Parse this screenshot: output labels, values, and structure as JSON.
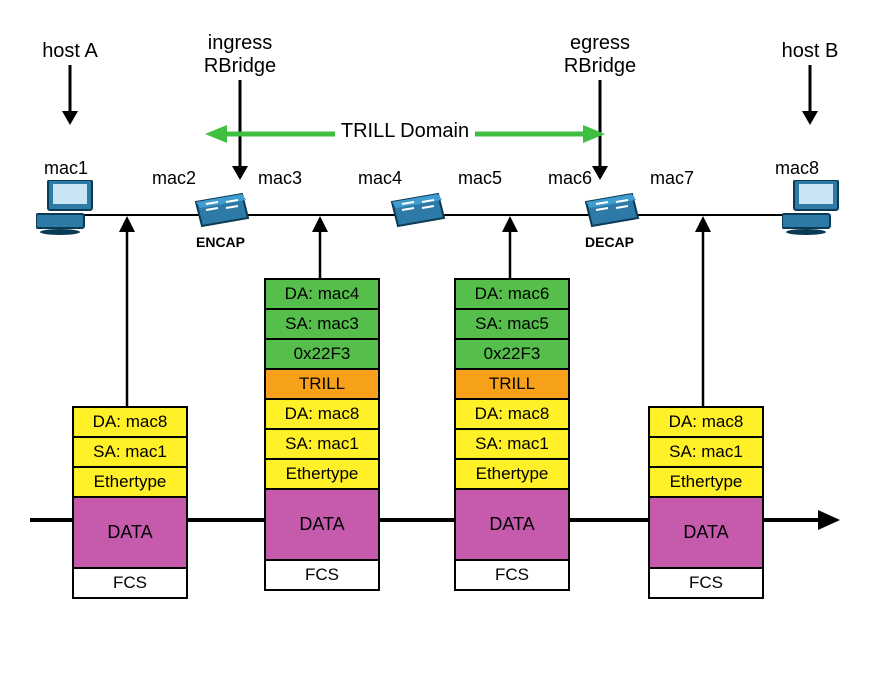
{
  "labels": {
    "hostA": "host A",
    "hostB": "host B",
    "ingress_l1": "ingress",
    "ingress_l2": "RBridge",
    "egress_l1": "egress",
    "egress_l2": "RBridge",
    "trill_domain": "TRILL Domain",
    "encap": "ENCAP",
    "decap": "DECAP"
  },
  "macs": {
    "m1": "mac1",
    "m2": "mac2",
    "m3": "mac3",
    "m4": "mac4",
    "m5": "mac5",
    "m6": "mac6",
    "m7": "mac7",
    "m8": "mac8"
  },
  "frames": [
    {
      "id": "f1",
      "cells": [
        {
          "text": "DA: mac8",
          "color": "yellow"
        },
        {
          "text": "SA: mac1",
          "color": "yellow"
        },
        {
          "text": "Ethertype",
          "color": "yellow"
        },
        {
          "text": "DATA",
          "color": "magenta",
          "big": true
        },
        {
          "text": "FCS",
          "color": "white"
        }
      ]
    },
    {
      "id": "f2",
      "cells": [
        {
          "text": "DA: mac4",
          "color": "green"
        },
        {
          "text": "SA: mac3",
          "color": "green"
        },
        {
          "text": "0x22F3",
          "color": "green"
        },
        {
          "text": "TRILL",
          "color": "orange"
        },
        {
          "text": "DA: mac8",
          "color": "yellow"
        },
        {
          "text": "SA: mac1",
          "color": "yellow"
        },
        {
          "text": "Ethertype",
          "color": "yellow"
        },
        {
          "text": "DATA",
          "color": "magenta",
          "big": true
        },
        {
          "text": "FCS",
          "color": "white"
        }
      ]
    },
    {
      "id": "f3",
      "cells": [
        {
          "text": "DA: mac6",
          "color": "green"
        },
        {
          "text": "SA: mac5",
          "color": "green"
        },
        {
          "text": "0x22F3",
          "color": "green"
        },
        {
          "text": "TRILL",
          "color": "orange"
        },
        {
          "text": "DA: mac8",
          "color": "yellow"
        },
        {
          "text": "SA: mac1",
          "color": "yellow"
        },
        {
          "text": "Ethertype",
          "color": "yellow"
        },
        {
          "text": "DATA",
          "color": "magenta",
          "big": true
        },
        {
          "text": "FCS",
          "color": "white"
        }
      ]
    },
    {
      "id": "f4",
      "cells": [
        {
          "text": "DA: mac8",
          "color": "yellow"
        },
        {
          "text": "SA: mac1",
          "color": "yellow"
        },
        {
          "text": "Ethertype",
          "color": "yellow"
        },
        {
          "text": "DATA",
          "color": "magenta",
          "big": true
        },
        {
          "text": "FCS",
          "color": "white"
        }
      ]
    }
  ]
}
